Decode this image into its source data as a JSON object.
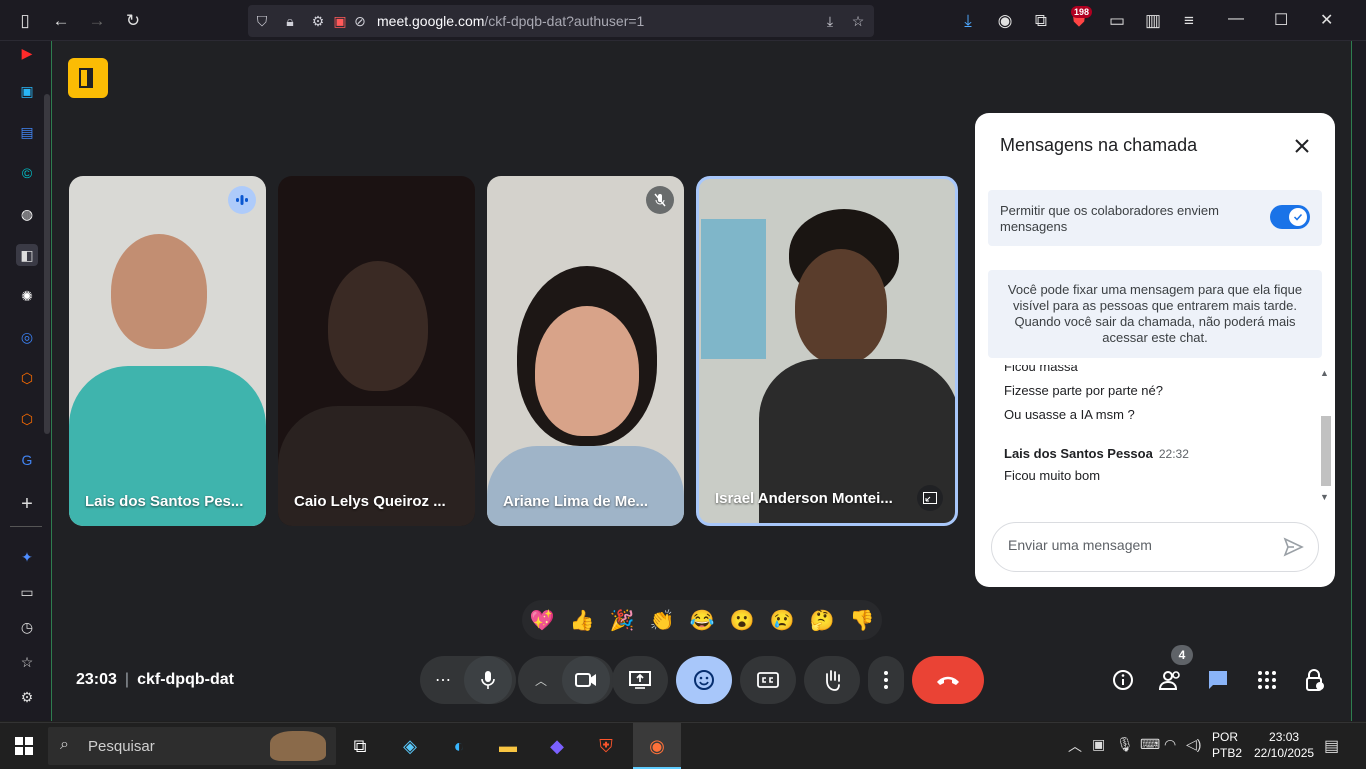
{
  "browser": {
    "url_host": "meet.google.com",
    "url_path": "/ckf-dpqb-dat?authuser=1",
    "badge_count": "198"
  },
  "tiles": [
    {
      "name": "Lais dos Santos Pes..."
    },
    {
      "name": "Caio Lelys Queiroz ..."
    },
    {
      "name": "Ariane Lima de Me..."
    },
    {
      "name": "Israel Anderson Montei..."
    }
  ],
  "chat": {
    "title": "Mensagens na chamada",
    "permission_label": "Permitir que os colaboradores enviem mensagens",
    "permission_enabled": true,
    "info_text": "Você pode fixar uma mensagem para que ela fique visível para as pessoas que entrarem mais tarde. Quando você sair da chamada, não poderá mais acessar este chat.",
    "messages": [
      {
        "text": "Ficou massa"
      },
      {
        "text": "Fizesse parte por parte né?"
      },
      {
        "text": "Ou usasse a IA msm ?"
      },
      {
        "sender": "Lais dos Santos Pessoa",
        "time": "22:32"
      },
      {
        "text": "Ficou muito bom"
      }
    ],
    "input_placeholder": "Enviar uma mensagem"
  },
  "reactions": [
    "💖",
    "👍",
    "🎉",
    "👏",
    "😂",
    "😮",
    "😢",
    "🤔",
    "👎"
  ],
  "meeting": {
    "time": "23:03",
    "code": "ckf-dpqb-dat",
    "people_count": "4"
  },
  "taskbar": {
    "search_label": "Pesquisar",
    "lang_line1": "POR",
    "lang_line2": "PTB2",
    "time": "23:03",
    "date": "22/10/2025"
  },
  "colors": {
    "accent": "#1a73e8",
    "end_call": "#ea4335",
    "active_control": "#a8c7fa",
    "exit_badge": "#fbbc04"
  }
}
